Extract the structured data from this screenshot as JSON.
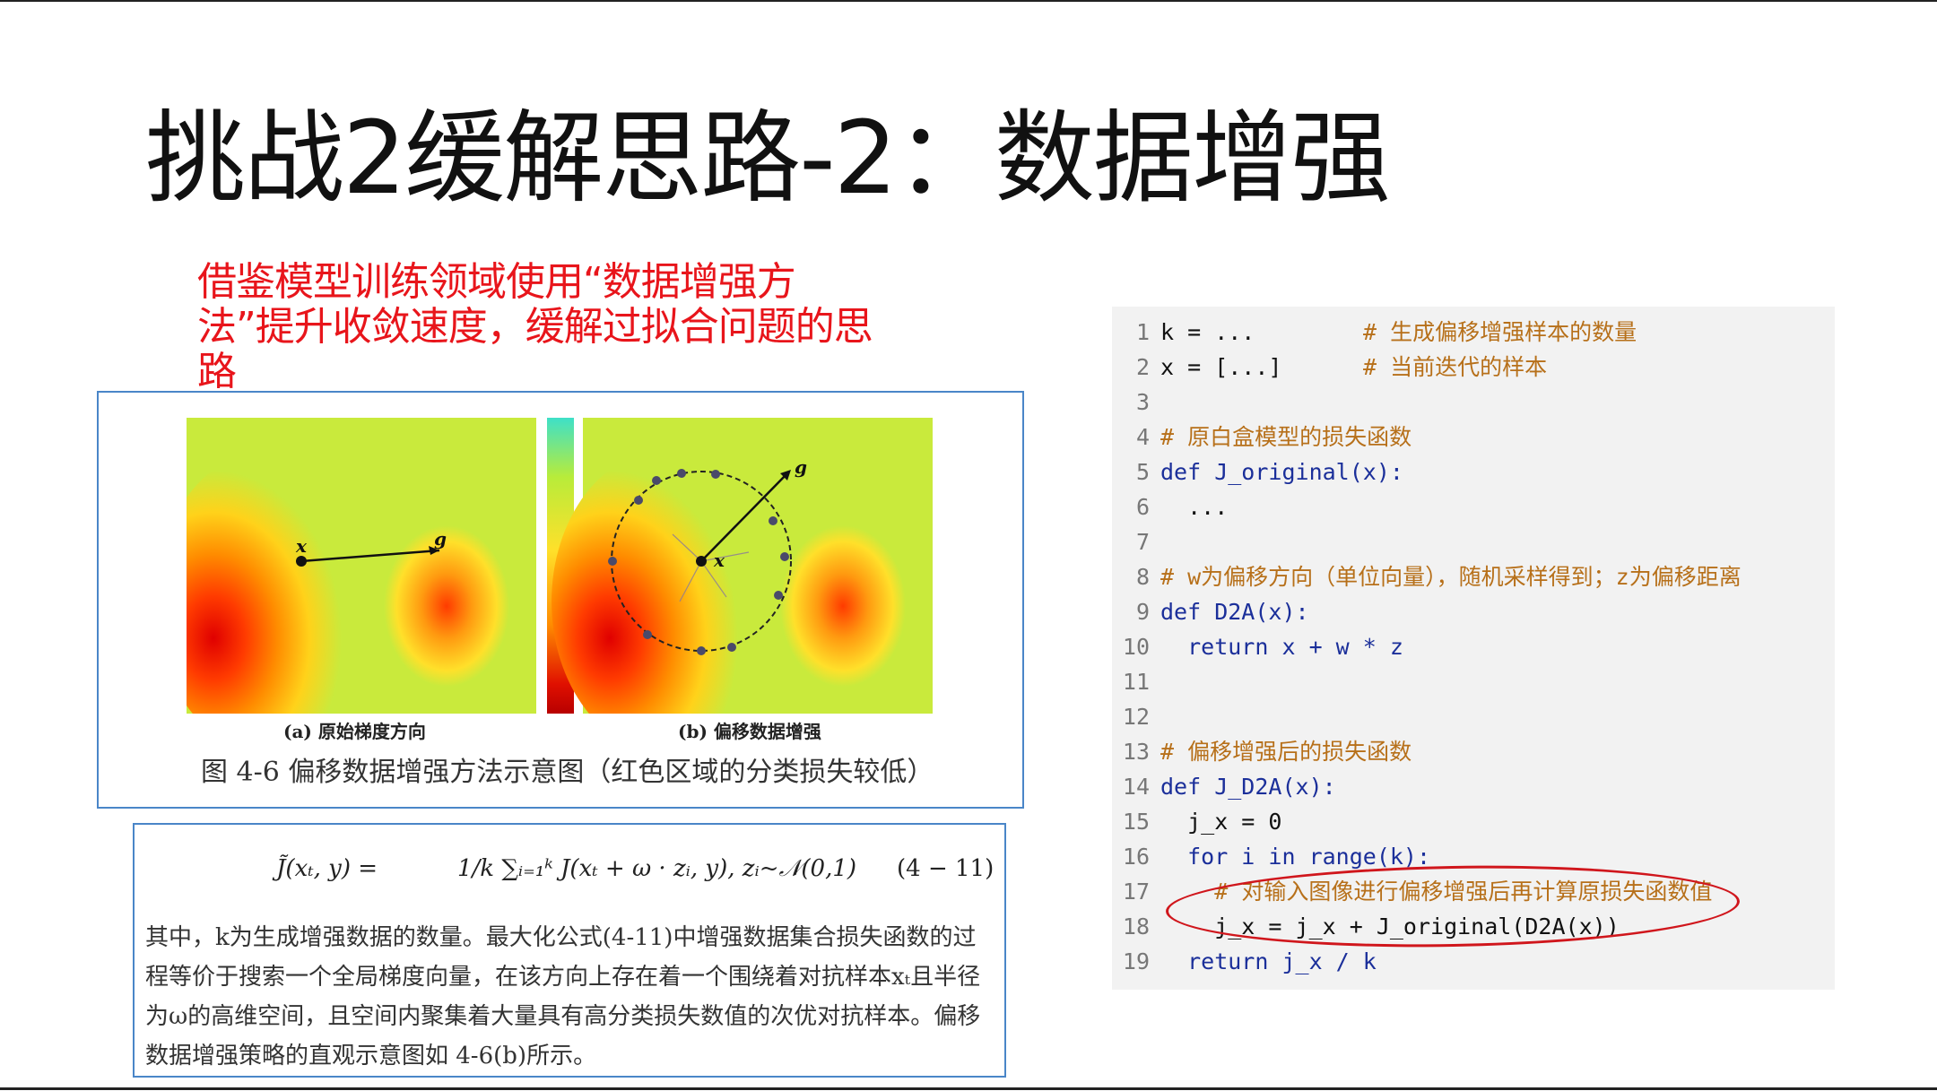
{
  "slide": {
    "title": "挑战2缓解思路-2：数据增强",
    "subtitle": "借鉴模型训练领域使用“数据增强方法”提升收敛速度，缓解过拟合问题的思路"
  },
  "figure": {
    "panel_a_label": "(a) 原始梯度方向",
    "panel_b_label": "(b) 偏移数据增强",
    "caption": "图 4-6  偏移数据增强方法示意图（红色区域的分类损失较低）",
    "point_x_label": "x",
    "point_g_label": "g",
    "colors": {
      "low_loss": "#d40000",
      "mid": "#ff8c00",
      "high": "#e8f23a",
      "background": "#c9ea3c",
      "colorbar_top": "#3ee0c8",
      "colorbar_bottom": "#b80000"
    }
  },
  "formula": {
    "lhs": "J̃(xₜ, y) =",
    "rhs": "1/k ∑ᵢ₌₁ᵏ J(xₜ + ω · zᵢ, y),    zᵢ~𝒩(0,1)",
    "number": "(4 − 11)",
    "paragraph": "其中，k为生成增强数据的数量。最大化公式(4-11)中增强数据集合损失函数的过程等价于搜索一个全局梯度向量，在该方向上存在着一个围绕着对抗样本xₜ且半径为ω的高维空间，且空间内聚集着大量具有高分类损失数值的次优对抗样本。偏移数据增强策略的直观示意图如 4-6(b)所示。"
  },
  "code": {
    "lines": [
      {
        "n": "1",
        "code": "k = ...",
        "comment": "# 生成偏移增强样本的数量"
      },
      {
        "n": "2",
        "code": "x = [...]",
        "comment": "# 当前迭代的样本"
      },
      {
        "n": "3",
        "code": "",
        "comment": ""
      },
      {
        "n": "4",
        "code": "",
        "comment": "# 原白盒模型的损失函数"
      },
      {
        "n": "5",
        "code": "def J_original(x):",
        "comment": ""
      },
      {
        "n": "6",
        "code": "  ...",
        "comment": ""
      },
      {
        "n": "7",
        "code": "",
        "comment": ""
      },
      {
        "n": "8",
        "code": "",
        "comment": "# w为偏移方向（单位向量），随机采样得到；z为偏移距离"
      },
      {
        "n": "9",
        "code": "def D2A(x):",
        "comment": ""
      },
      {
        "n": "10",
        "code": "  return x + w * z",
        "comment": ""
      },
      {
        "n": "11",
        "code": "",
        "comment": ""
      },
      {
        "n": "12",
        "code": "",
        "comment": ""
      },
      {
        "n": "13",
        "code": "",
        "comment": "# 偏移增强后的损失函数"
      },
      {
        "n": "14",
        "code": "def J_D2A(x):",
        "comment": ""
      },
      {
        "n": "15",
        "code": "  j_x = 0",
        "comment": ""
      },
      {
        "n": "16",
        "code": "  for i in range(k):",
        "comment": ""
      },
      {
        "n": "17",
        "code": "    ",
        "comment": "# 对输入图像进行偏移增强后再计算原损失函数值"
      },
      {
        "n": "18",
        "code": "    j_x = j_x + J_original(D2A(x))",
        "comment": ""
      },
      {
        "n": "19",
        "code": "  return j_x / k",
        "comment": ""
      }
    ],
    "highlight_color": "#d0161c"
  }
}
